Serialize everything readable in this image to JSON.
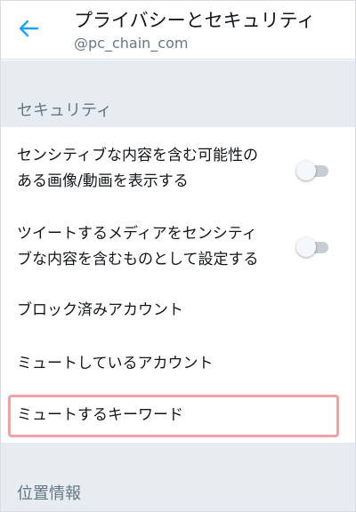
{
  "header": {
    "title": "プライバシーとセキュリティ",
    "username": "@pc_chain_com",
    "back_icon": "arrow-left-icon",
    "accent": "#1da1f2"
  },
  "sections": {
    "security": "セキュリティ",
    "location": "位置情報"
  },
  "rows": {
    "sensitive_display": {
      "line1": "センシティブな内容を含む可能性の",
      "line2": "ある画像/動画を表示する",
      "toggle_on": false
    },
    "sensitive_mark": {
      "line1": "ツイートするメディアをセンシティ",
      "line2": "ブな内容を含むものとして設定する",
      "toggle_on": false
    },
    "blocked": "ブロック済みアカウント",
    "muted_accounts": "ミュートしているアカウント",
    "muted_keywords": "ミュートするキーワード"
  },
  "highlight_color": "#f29fa6"
}
